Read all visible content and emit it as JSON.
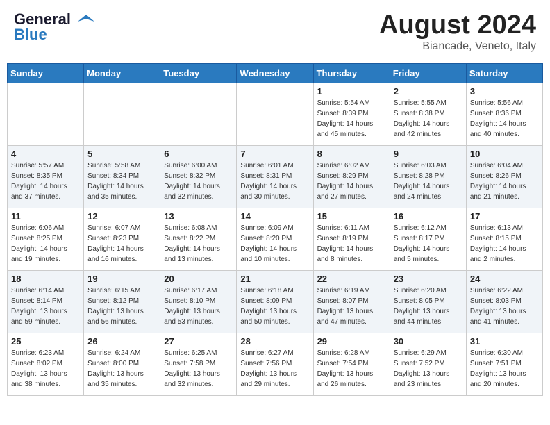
{
  "header": {
    "logo_line1": "General",
    "logo_line2": "Blue",
    "month_year": "August 2024",
    "location": "Biancade, Veneto, Italy"
  },
  "days_of_week": [
    "Sunday",
    "Monday",
    "Tuesday",
    "Wednesday",
    "Thursday",
    "Friday",
    "Saturday"
  ],
  "weeks": [
    [
      {
        "day": "",
        "info": ""
      },
      {
        "day": "",
        "info": ""
      },
      {
        "day": "",
        "info": ""
      },
      {
        "day": "",
        "info": ""
      },
      {
        "day": "1",
        "info": "Sunrise: 5:54 AM\nSunset: 8:39 PM\nDaylight: 14 hours\nand 45 minutes."
      },
      {
        "day": "2",
        "info": "Sunrise: 5:55 AM\nSunset: 8:38 PM\nDaylight: 14 hours\nand 42 minutes."
      },
      {
        "day": "3",
        "info": "Sunrise: 5:56 AM\nSunset: 8:36 PM\nDaylight: 14 hours\nand 40 minutes."
      }
    ],
    [
      {
        "day": "4",
        "info": "Sunrise: 5:57 AM\nSunset: 8:35 PM\nDaylight: 14 hours\nand 37 minutes."
      },
      {
        "day": "5",
        "info": "Sunrise: 5:58 AM\nSunset: 8:34 PM\nDaylight: 14 hours\nand 35 minutes."
      },
      {
        "day": "6",
        "info": "Sunrise: 6:00 AM\nSunset: 8:32 PM\nDaylight: 14 hours\nand 32 minutes."
      },
      {
        "day": "7",
        "info": "Sunrise: 6:01 AM\nSunset: 8:31 PM\nDaylight: 14 hours\nand 30 minutes."
      },
      {
        "day": "8",
        "info": "Sunrise: 6:02 AM\nSunset: 8:29 PM\nDaylight: 14 hours\nand 27 minutes."
      },
      {
        "day": "9",
        "info": "Sunrise: 6:03 AM\nSunset: 8:28 PM\nDaylight: 14 hours\nand 24 minutes."
      },
      {
        "day": "10",
        "info": "Sunrise: 6:04 AM\nSunset: 8:26 PM\nDaylight: 14 hours\nand 21 minutes."
      }
    ],
    [
      {
        "day": "11",
        "info": "Sunrise: 6:06 AM\nSunset: 8:25 PM\nDaylight: 14 hours\nand 19 minutes."
      },
      {
        "day": "12",
        "info": "Sunrise: 6:07 AM\nSunset: 8:23 PM\nDaylight: 14 hours\nand 16 minutes."
      },
      {
        "day": "13",
        "info": "Sunrise: 6:08 AM\nSunset: 8:22 PM\nDaylight: 14 hours\nand 13 minutes."
      },
      {
        "day": "14",
        "info": "Sunrise: 6:09 AM\nSunset: 8:20 PM\nDaylight: 14 hours\nand 10 minutes."
      },
      {
        "day": "15",
        "info": "Sunrise: 6:11 AM\nSunset: 8:19 PM\nDaylight: 14 hours\nand 8 minutes."
      },
      {
        "day": "16",
        "info": "Sunrise: 6:12 AM\nSunset: 8:17 PM\nDaylight: 14 hours\nand 5 minutes."
      },
      {
        "day": "17",
        "info": "Sunrise: 6:13 AM\nSunset: 8:15 PM\nDaylight: 14 hours\nand 2 minutes."
      }
    ],
    [
      {
        "day": "18",
        "info": "Sunrise: 6:14 AM\nSunset: 8:14 PM\nDaylight: 13 hours\nand 59 minutes."
      },
      {
        "day": "19",
        "info": "Sunrise: 6:15 AM\nSunset: 8:12 PM\nDaylight: 13 hours\nand 56 minutes."
      },
      {
        "day": "20",
        "info": "Sunrise: 6:17 AM\nSunset: 8:10 PM\nDaylight: 13 hours\nand 53 minutes."
      },
      {
        "day": "21",
        "info": "Sunrise: 6:18 AM\nSunset: 8:09 PM\nDaylight: 13 hours\nand 50 minutes."
      },
      {
        "day": "22",
        "info": "Sunrise: 6:19 AM\nSunset: 8:07 PM\nDaylight: 13 hours\nand 47 minutes."
      },
      {
        "day": "23",
        "info": "Sunrise: 6:20 AM\nSunset: 8:05 PM\nDaylight: 13 hours\nand 44 minutes."
      },
      {
        "day": "24",
        "info": "Sunrise: 6:22 AM\nSunset: 8:03 PM\nDaylight: 13 hours\nand 41 minutes."
      }
    ],
    [
      {
        "day": "25",
        "info": "Sunrise: 6:23 AM\nSunset: 8:02 PM\nDaylight: 13 hours\nand 38 minutes."
      },
      {
        "day": "26",
        "info": "Sunrise: 6:24 AM\nSunset: 8:00 PM\nDaylight: 13 hours\nand 35 minutes."
      },
      {
        "day": "27",
        "info": "Sunrise: 6:25 AM\nSunset: 7:58 PM\nDaylight: 13 hours\nand 32 minutes."
      },
      {
        "day": "28",
        "info": "Sunrise: 6:27 AM\nSunset: 7:56 PM\nDaylight: 13 hours\nand 29 minutes."
      },
      {
        "day": "29",
        "info": "Sunrise: 6:28 AM\nSunset: 7:54 PM\nDaylight: 13 hours\nand 26 minutes."
      },
      {
        "day": "30",
        "info": "Sunrise: 6:29 AM\nSunset: 7:52 PM\nDaylight: 13 hours\nand 23 minutes."
      },
      {
        "day": "31",
        "info": "Sunrise: 6:30 AM\nSunset: 7:51 PM\nDaylight: 13 hours\nand 20 minutes."
      }
    ]
  ]
}
